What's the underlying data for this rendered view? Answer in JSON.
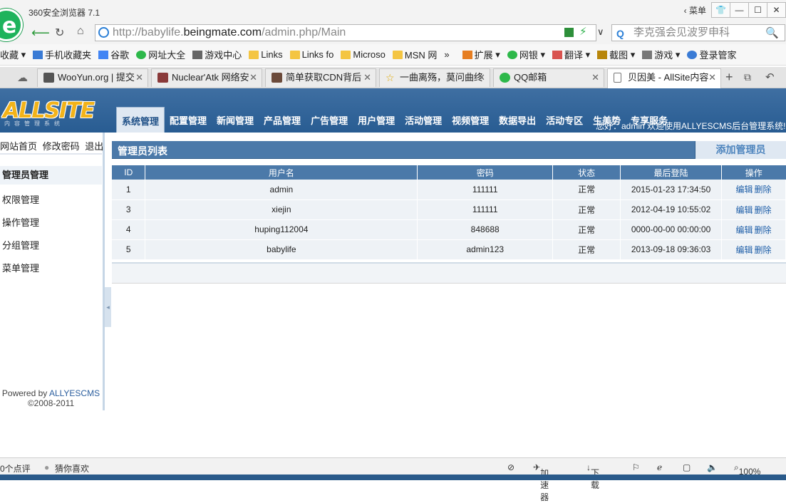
{
  "browser": {
    "title": "360安全浏览器 7.1",
    "menu_label": "菜单",
    "logo_letter": "e",
    "address_prefix": "http://babylife.",
    "address_domain": "beingmate.com",
    "address_path": "/admin.php/Main",
    "search_placeholder": "李克强会见波罗申科",
    "favorites": [
      "收藏",
      "手机收藏夹",
      "谷歌",
      "网址大全",
      "游戏中心",
      "Links",
      "Links fo",
      "Microso",
      "MSN 网",
      "»"
    ],
    "toolbar": [
      "扩展",
      "网银",
      "翻译",
      "截图",
      "游戏",
      "登录管家"
    ],
    "tabs": [
      {
        "title": "WooYun.org | 提交"
      },
      {
        "title": "Nuclear'Atk 网络安"
      },
      {
        "title": "简单获取CDN背后"
      },
      {
        "title": "一曲离殇，莫问曲终"
      },
      {
        "title": "QQ邮箱"
      },
      {
        "title": "贝因美 - AllSite内容"
      }
    ],
    "status": {
      "left1": "0个点评",
      "left2": "猜你喜欢",
      "accelerator": "加速器",
      "download": "下载",
      "zoom": "100%"
    }
  },
  "app": {
    "logo": "ALLSITE",
    "logo_sub": "内容管理系统",
    "nav": [
      "系统管理",
      "配置管理",
      "新闻管理",
      "产品管理",
      "广告管理",
      "用户管理",
      "活动管理",
      "视频管理",
      "数据导出",
      "活动专区",
      "生美势",
      "专享服务"
    ],
    "welcome": "您好：admin 欢迎使用ALLYESCMS后台管理系统!",
    "toplinks": "网站首页 修改密码 退出",
    "sidebar": [
      "管理员管理",
      "权限管理",
      "操作管理",
      "分组管理",
      "菜单管理"
    ],
    "powered_prefix": "Powered by",
    "powered_brand": "ALLYESCMS",
    "copyright": "©2008-2011",
    "panel_title": "管理员列表",
    "add_label": "添加管理员",
    "table": {
      "headers": [
        "ID",
        "用户名",
        "密码",
        "状态",
        "最后登陆",
        "操作"
      ],
      "rows": [
        {
          "id": "1",
          "user": "admin",
          "pwd": "111111",
          "status": "正常",
          "last": "2015-01-23 17:34:50"
        },
        {
          "id": "3",
          "user": "xiejin",
          "pwd": "111111",
          "status": "正常",
          "last": "2012-04-19 10:55:02"
        },
        {
          "id": "4",
          "user": "huping112004",
          "pwd": "848688",
          "status": "正常",
          "last": "0000-00-00 00:00:00"
        },
        {
          "id": "5",
          "user": "babylife",
          "pwd": "admin123",
          "status": "正常",
          "last": "2013-09-18 09:36:03"
        }
      ],
      "edit": "编辑",
      "delete": "删除"
    }
  }
}
